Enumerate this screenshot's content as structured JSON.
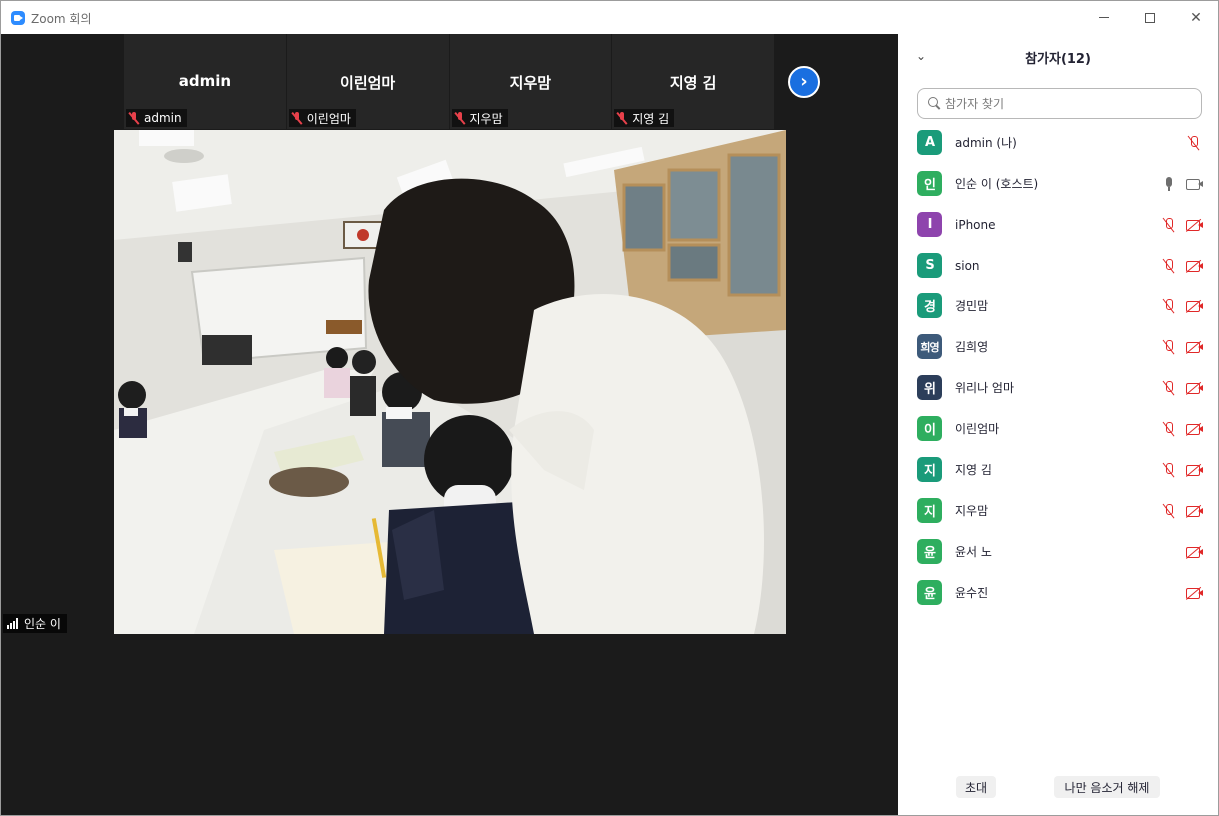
{
  "window": {
    "title": "Zoom 회의",
    "icons": {
      "app": "zoom-logo-icon",
      "minimize": "minimize-icon",
      "maximize": "maximize-icon",
      "close": "close-icon"
    }
  },
  "thumbnails": [
    {
      "name": "admin",
      "tag": "admin"
    },
    {
      "name": "이린엄마",
      "tag": "이린엄마"
    },
    {
      "name": "지우맘",
      "tag": "지우맘"
    },
    {
      "name": "지영 김",
      "tag": "지영 김"
    }
  ],
  "next_button": "›",
  "active_speaker": "인순 이",
  "panel": {
    "collapse": "⌄",
    "title": "참가자(12)",
    "search_placeholder": "참가자 찾기"
  },
  "participants": [
    {
      "initial": "A",
      "name": "admin (나)",
      "color": "#1a9b7a",
      "mic": "muted",
      "video": "none"
    },
    {
      "initial": "인",
      "name": "인순 이 (호스트)",
      "color": "#2eae5f",
      "mic": "on",
      "video": "on"
    },
    {
      "initial": "I",
      "name": "iPhone",
      "color": "#8e44ad",
      "mic": "muted",
      "video": "muted"
    },
    {
      "initial": "S",
      "name": "sion",
      "color": "#1a9b7a",
      "mic": "muted",
      "video": "muted"
    },
    {
      "initial": "경",
      "name": "경민맘",
      "color": "#1a9b7a",
      "mic": "muted",
      "video": "muted"
    },
    {
      "initial": "희영",
      "name": "김희영",
      "color": "#3d5a7a",
      "mic": "muted",
      "video": "muted"
    },
    {
      "initial": "위",
      "name": "위리나 엄마",
      "color": "#2c3e5a",
      "mic": "muted",
      "video": "muted"
    },
    {
      "initial": "이",
      "name": "이린엄마",
      "color": "#2eae5f",
      "mic": "muted",
      "video": "muted"
    },
    {
      "initial": "지",
      "name": "지영 김",
      "color": "#1a9b7a",
      "mic": "muted",
      "video": "muted"
    },
    {
      "initial": "지",
      "name": "지우맘",
      "color": "#2eae5f",
      "mic": "muted",
      "video": "muted"
    },
    {
      "initial": "윤",
      "name": "윤서 노",
      "color": "#2eae5f",
      "mic": "none",
      "video": "muted"
    },
    {
      "initial": "윤",
      "name": "윤수진",
      "color": "#2eae5f",
      "mic": "none",
      "video": "muted"
    }
  ],
  "footer": {
    "invite": "초대",
    "unmute_me": "나만 음소거 해제"
  }
}
